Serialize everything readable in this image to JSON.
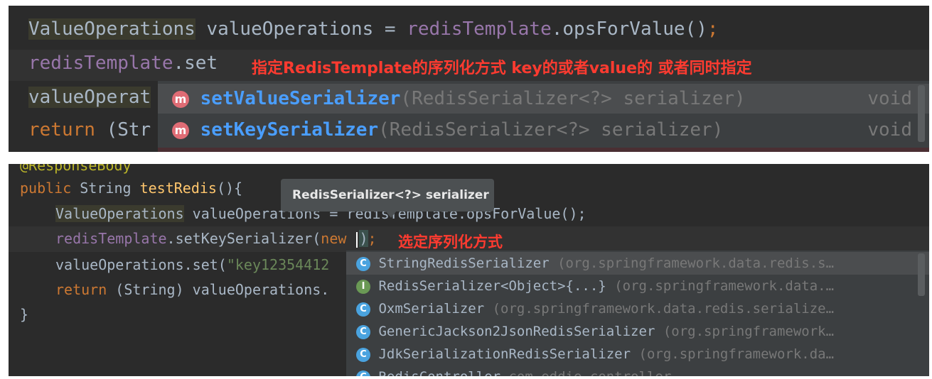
{
  "top": {
    "line1": {
      "type": "ValueOperations",
      "rest": " valueOperations = ",
      "field": "redisTemplate",
      "call": ".opsForValue()",
      "semi": ";"
    },
    "line2": {
      "field": "redisTemplate",
      "call": ".set"
    },
    "line3": {
      "text": "valueOperat"
    },
    "line4": {
      "kw": "return",
      "rest": " (Str"
    },
    "annotation": "指定RedisTemplate的序列化方式 key的或者value的 或者同时指定",
    "completion": [
      {
        "badge": "m",
        "name": "setValueSerializer",
        "params": "(RedisSerializer<?> serializer)",
        "ret": "void"
      },
      {
        "badge": "m",
        "name": "setKeySerializer",
        "params": "(RedisSerializer<?> serializer)",
        "ret": "void"
      }
    ]
  },
  "bottom": {
    "partial_annotation": "@ResponseBody",
    "method": {
      "kw": "public",
      "type": " String ",
      "name": "testRedis",
      "rest": "(){"
    },
    "line_ops": {
      "type": "ValueOperations",
      "rest": " valueOperations = redisTemplate.opsForValue();"
    },
    "line_set": {
      "field": "redisTemplate",
      "call": ".setKeySerializer(",
      "kw": "new ",
      "close": ")",
      "semi": ";"
    },
    "annotation": "选定序列化方式",
    "line_value": {
      "text": "valueOperations.set(",
      "str": "\"key12354412"
    },
    "line_return": {
      "kw": "return",
      "rest": " (String) valueOperations."
    },
    "close_brace": "}",
    "tooltip": "RedisSerializer<?> serializer",
    "completion": [
      {
        "badge": "C",
        "name": "StringRedisSerializer",
        "pkg": " (org.springframework.data.redis.s…"
      },
      {
        "badge": "I",
        "name": "RedisSerializer<Object>{...}",
        "pkg": " (org.springframework.data.…"
      },
      {
        "badge": "C",
        "name": "OxmSerializer",
        "pkg": " (org.springframework.data.redis.serialize…"
      },
      {
        "badge": "C",
        "name": "GenericJackson2JsonRedisSerializer",
        "pkg": " (org.springframework…"
      },
      {
        "badge": "C",
        "name": "JdkSerializationRedisSerializer",
        "pkg": " (org.springframework.da…"
      },
      {
        "badge": "C",
        "name": "RedisController",
        "pkg": " com.eddie.controller"
      }
    ]
  },
  "colors": {
    "editor_bg": "#2b2b2b",
    "popup_bg": "#3c3f41",
    "accent_red": "#ff3b30",
    "method_blue": "#4a9eff"
  }
}
